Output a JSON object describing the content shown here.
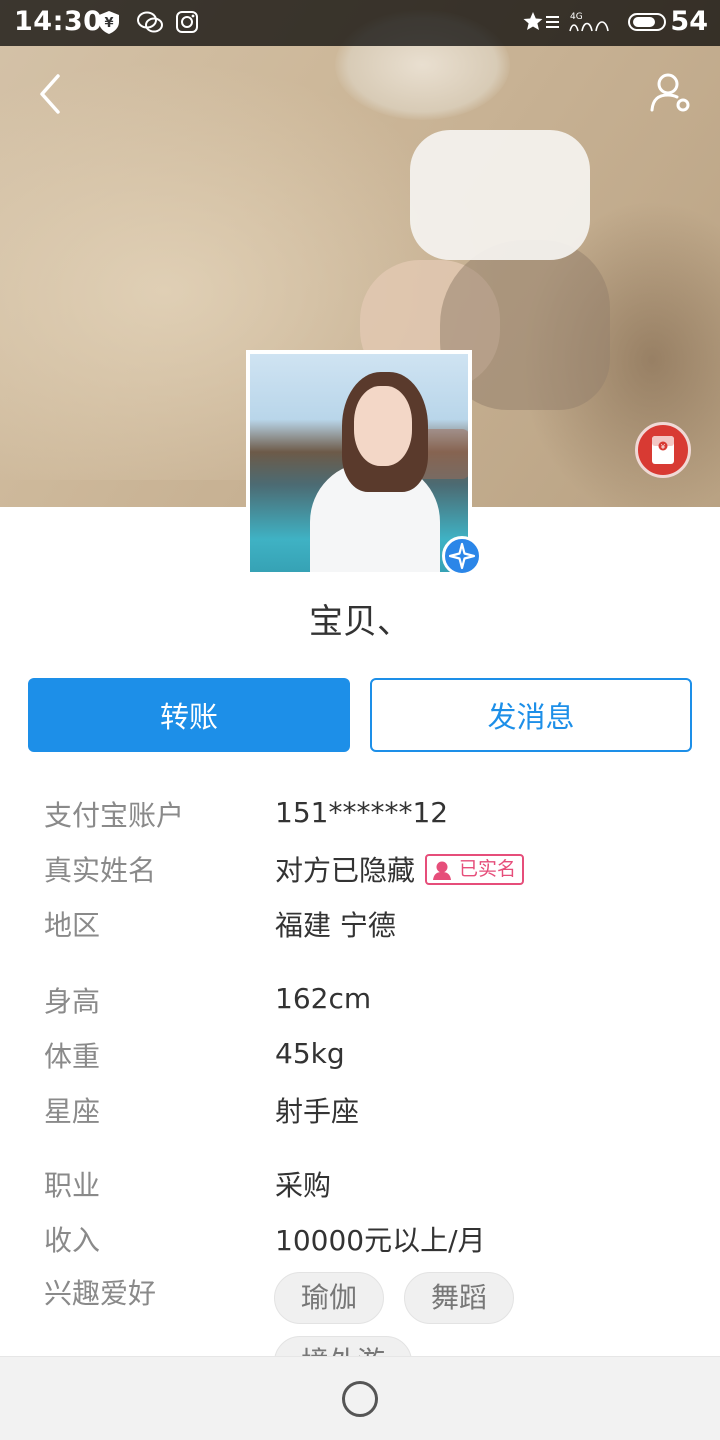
{
  "status_bar": {
    "time": "14:30",
    "battery_level": "54",
    "icons": [
      "shield-yen-icon",
      "wechat-icon",
      "instagram-icon",
      "star-notification-icon",
      "signal-4g-icon",
      "battery-icon"
    ],
    "network_label": "4G"
  },
  "nav": {
    "back_icon": "chevron-left-icon",
    "profile_icon": "user-settings-icon"
  },
  "profile": {
    "name": "宝贝、",
    "verified": true
  },
  "actions": {
    "transfer_label": "转账",
    "message_label": "发消息",
    "accent_color": "#1d8fe8"
  },
  "info": {
    "account_label": "支付宝账户",
    "account_value": "151******12",
    "realname_label": "真实姓名",
    "realname_value": "对方已隐藏",
    "realname_badge": "已实名",
    "region_label": "地区",
    "region_value": "福建 宁德",
    "height_label": "身高",
    "height_value": "162cm",
    "weight_label": "体重",
    "weight_value": "45kg",
    "zodiac_label": "星座",
    "zodiac_value": "射手座",
    "job_label": "职业",
    "job_value": "采购",
    "income_label": "收入",
    "income_value": "10000元以上/月",
    "hobbies_label": "兴趣爱好",
    "hobbies": [
      "瑜伽",
      "舞蹈",
      "境外游"
    ]
  },
  "bottom_nav": {
    "home_icon": "home-circle-icon"
  }
}
